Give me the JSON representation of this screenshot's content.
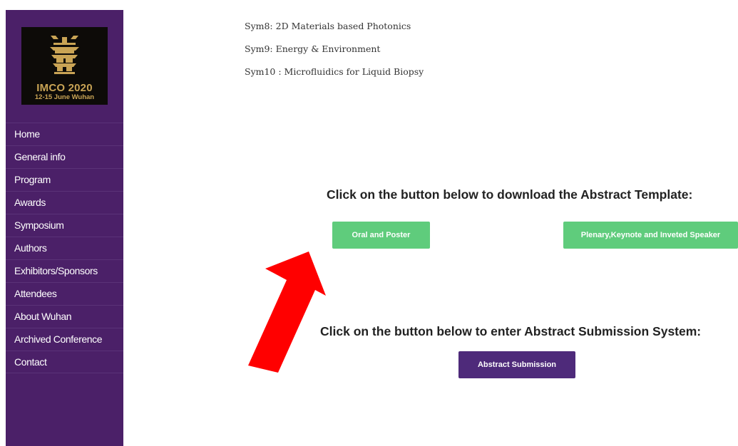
{
  "logo": {
    "title": "IMCO 2020",
    "subtitle": "12-15 June  Wuhan",
    "accent": "#c9a455"
  },
  "nav": [
    "Home",
    "General info",
    "Program",
    "Awards",
    "Symposium",
    "Authors",
    "Exhibitors/Sponsors",
    "Attendees",
    "About Wuhan",
    "Archived Conference",
    "Contact"
  ],
  "symposia": [
    "Sym8: 2D Materials based Photonics",
    "Sym9: Energy & Environment",
    "Sym10 : Microfluidics for Liquid Biopsy"
  ],
  "template_section": {
    "heading": "Click on the button below to download the Abstract Template:",
    "button_oral": "Oral and Poster",
    "button_plenary": "Plenary,Keynote and Inveted Speaker"
  },
  "submission_section": {
    "heading": "Click on the button below to enter Abstract Submission System:",
    "button": "Abstract Submission"
  },
  "colors": {
    "sidebar": "#4b2068",
    "green_button": "#5fcc7c",
    "purple_button": "#4e2a7a",
    "arrow": "#ff0000"
  }
}
